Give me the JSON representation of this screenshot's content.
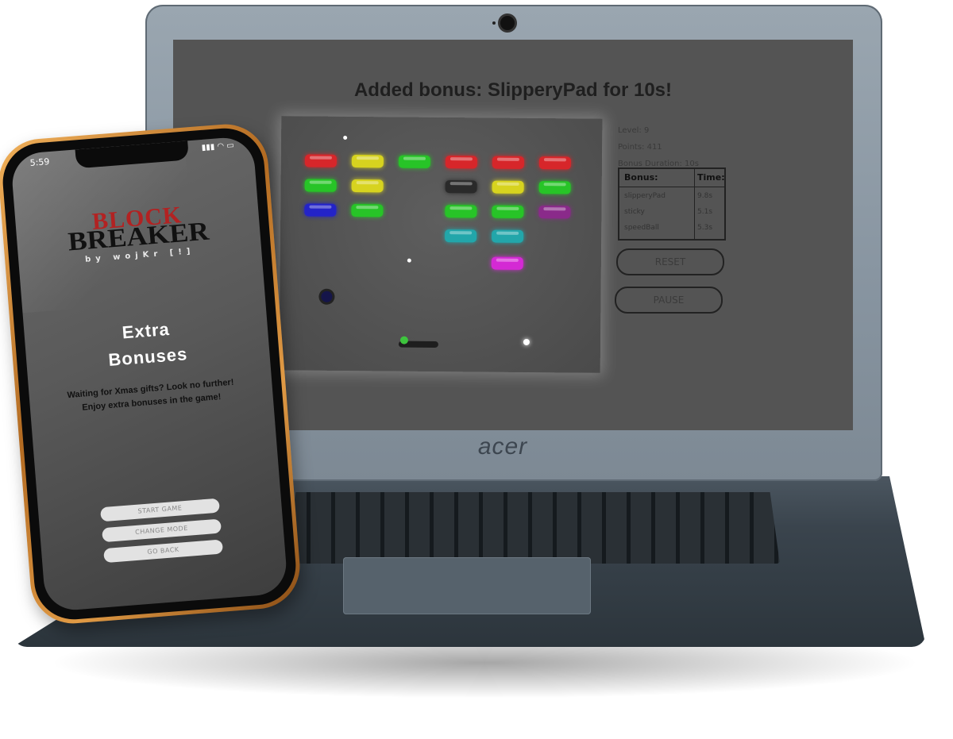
{
  "laptop": {
    "brand": "acer",
    "game": {
      "bonus_message": "Added bonus: SlipperyPad for 10s!",
      "stats": {
        "level": "Level: 9",
        "points": "Points: 411",
        "bonus_duration": "Bonus Duration: 10s"
      },
      "bonus_table": {
        "headers": [
          "Bonus:",
          "Time:"
        ],
        "rows": [
          {
            "bonus": "slipperyPad",
            "time": "9.8s"
          },
          {
            "bonus": "sticky",
            "time": "5.1s"
          },
          {
            "bonus": "speedBall",
            "time": "5.3s"
          }
        ]
      },
      "buttons": {
        "reset": "RESET",
        "pause": "PAUSE"
      },
      "brick_colors": {
        "red": "#d7262a",
        "yellow": "#d7d31f",
        "green": "#27c427",
        "blue": "#2323c8",
        "black": "#2a2a2a",
        "cyan": "#22a6aa",
        "purple": "#8a2a8a",
        "magenta": "#d429d4"
      }
    }
  },
  "phone": {
    "status": {
      "time": "5:59",
      "icons": "▮▮▮ ◠ ▭"
    },
    "logo": {
      "top": "BLOCK",
      "main": "BREAKER",
      "byline": "by wojKr [!]"
    },
    "title_line1": "Extra",
    "title_line2": "Bonuses",
    "description": "Waiting for Xmas gifts? Look no further! Enjoy extra bonuses in the game!",
    "buttons": {
      "start": "START GAME",
      "change_mode": "CHANGE MODE",
      "go_back": "GO BACK"
    }
  }
}
